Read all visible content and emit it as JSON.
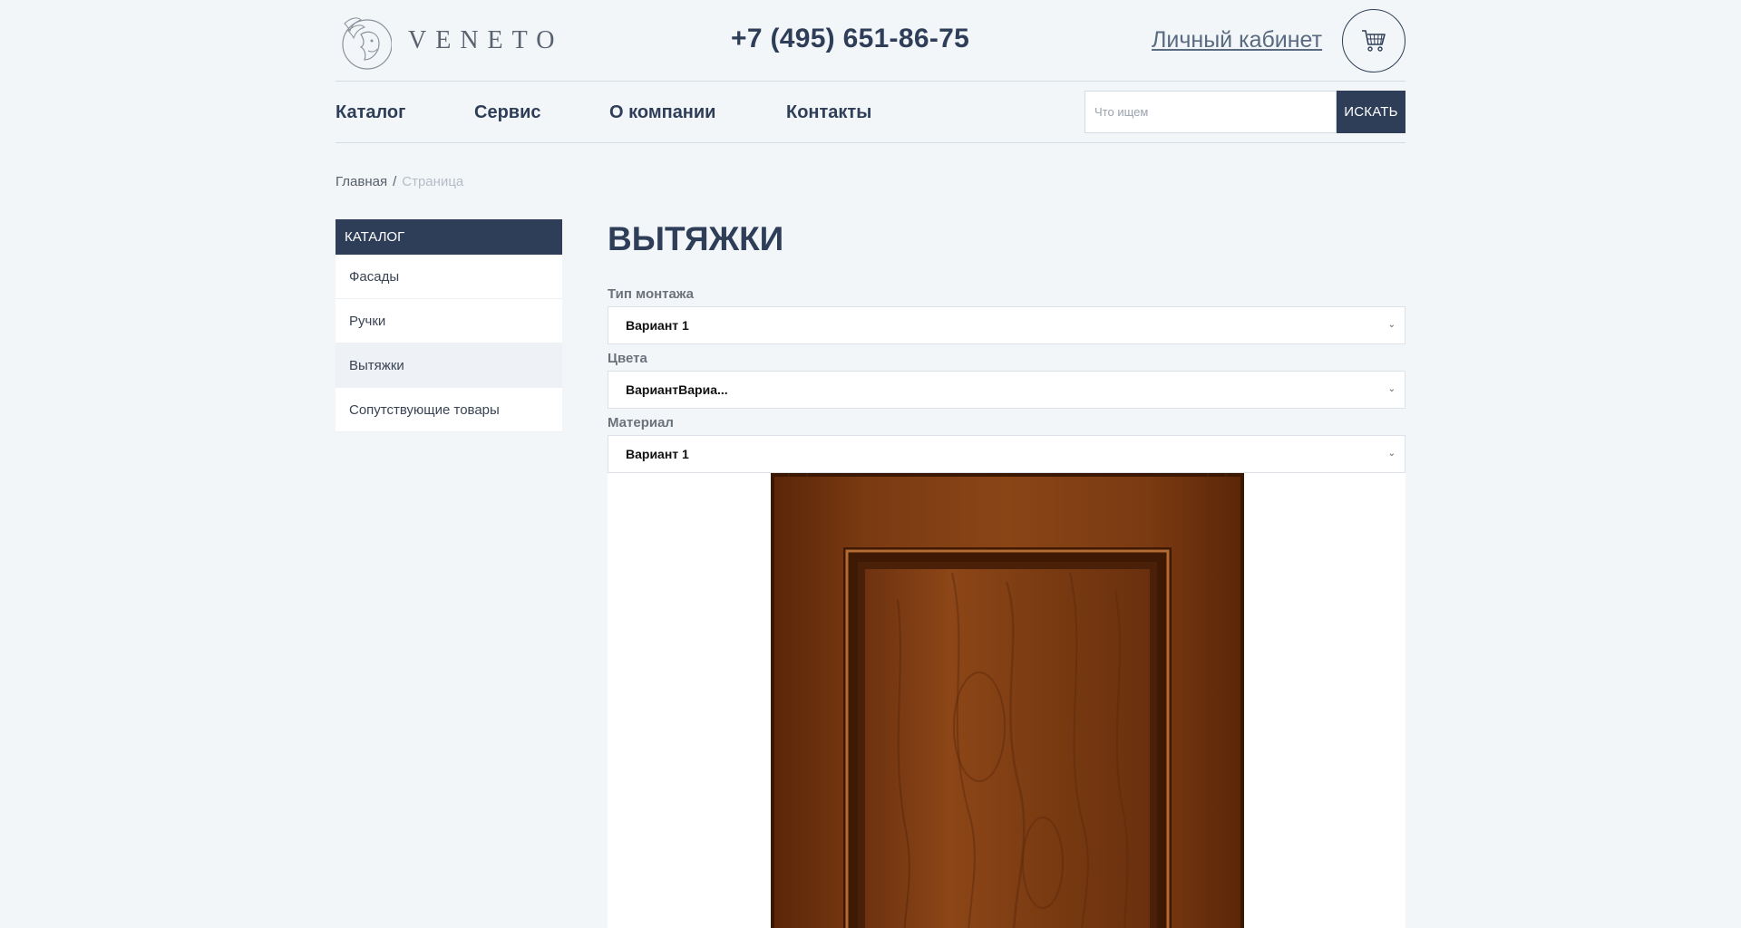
{
  "header": {
    "logo_text": "VENETO",
    "phone": "+7 (495) 651-86-75",
    "cabinet_link": "Личный кабинет"
  },
  "nav": {
    "items": [
      "Каталог",
      "Сервис",
      "О компании",
      "Контакты"
    ],
    "search_placeholder": "Что ищем",
    "search_button": "ИСКАТЬ"
  },
  "breadcrumb": {
    "home": "Главная",
    "separator": "/",
    "current": "Страница"
  },
  "sidebar": {
    "heading": "КАТАЛОГ",
    "items": [
      "Фасады",
      "Ручки",
      "Вытяжки",
      "Сопутствующие товары"
    ],
    "active_index": 2
  },
  "main": {
    "title": "ВЫТЯЖКИ",
    "filters": [
      {
        "label": "Тип монтажа",
        "value": "Вариант 1"
      },
      {
        "label": "Цвета",
        "value": "ВариантВариа..."
      },
      {
        "label": "Материал",
        "value": "Вариант 1"
      }
    ]
  },
  "colors": {
    "primary": "#2e3e58",
    "background": "#f3f6f9",
    "wood": "#7a3a12"
  },
  "icons": [
    "logo-lion-icon",
    "cart-icon",
    "chevron-down-icon"
  ]
}
